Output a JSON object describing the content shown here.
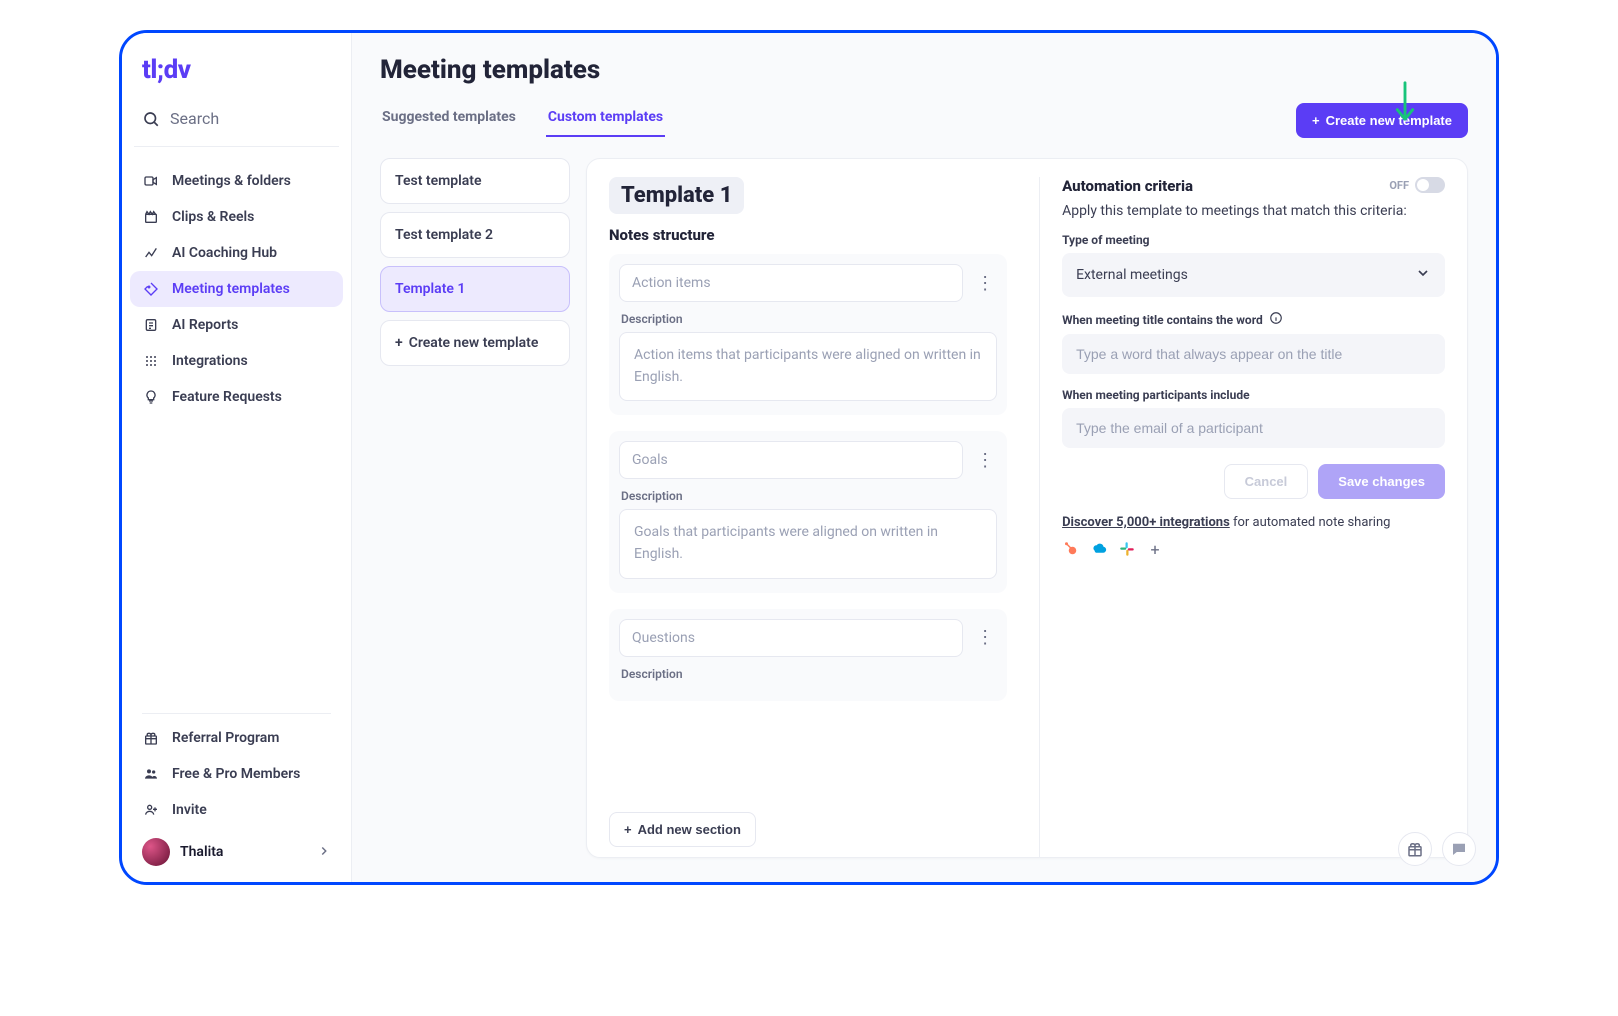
{
  "brand": "tl;dv",
  "sidebar": {
    "search": "Search",
    "nav": [
      {
        "label": "Meetings & folders"
      },
      {
        "label": "Clips & Reels"
      },
      {
        "label": "AI Coaching Hub"
      },
      {
        "label": "Meeting templates"
      },
      {
        "label": "AI Reports"
      },
      {
        "label": "Integrations"
      },
      {
        "label": "Feature Requests"
      }
    ],
    "bottom": [
      {
        "label": "Referral Program"
      },
      {
        "label": "Free & Pro Members"
      },
      {
        "label": "Invite"
      }
    ],
    "profile_name": "Thalita"
  },
  "header": {
    "title": "Meeting templates",
    "tabs": [
      "Suggested templates",
      "Custom templates"
    ],
    "active_tab": 1,
    "create_btn": "Create new template"
  },
  "template_list": {
    "items": [
      "Test template",
      "Test template 2",
      "Template 1"
    ],
    "active_index": 2,
    "create_label": "Create new template"
  },
  "editor": {
    "name": "Template 1",
    "toggle_label": "OFF",
    "notes_heading": "Notes structure",
    "desc_label": "Description",
    "add_section": "Add new section",
    "sections": [
      {
        "title": "Action items",
        "desc": "Action items that participants were aligned on written in English."
      },
      {
        "title": "Goals",
        "desc": "Goals that participants were aligned on written in English."
      },
      {
        "title": "Questions",
        "desc": ""
      }
    ]
  },
  "automation": {
    "heading": "Automation criteria",
    "subheading": "Apply this template to meetings that match this criteria:",
    "type_label": "Type of meeting",
    "type_value": "External meetings",
    "title_contains_label": "When meeting title contains the word",
    "title_contains_placeholder": "Type a word that always appear on the title",
    "participants_label": "When meeting participants include",
    "participants_placeholder": "Type the email of a participant",
    "cancel": "Cancel",
    "save": "Save changes",
    "discover_text_strong": "Discover 5,000+ integrations",
    "discover_text_rest": " for automated note sharing"
  }
}
